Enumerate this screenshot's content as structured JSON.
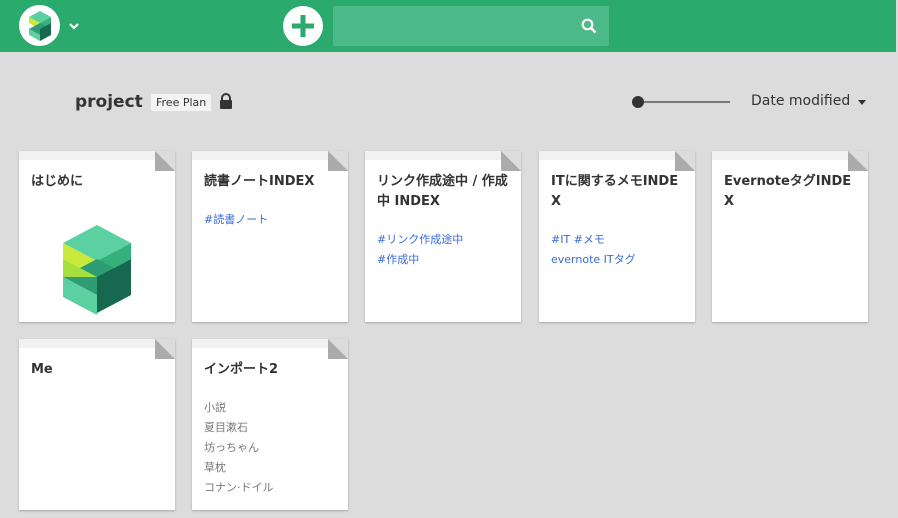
{
  "header": {
    "search_placeholder": ""
  },
  "project": {
    "name": "project",
    "plan": "Free Plan",
    "sort_label": "Date modified"
  },
  "cards": [
    {
      "title": "はじめに"
    },
    {
      "title": "読書ノートINDEX",
      "tags": [
        "#読書ノート"
      ]
    },
    {
      "title": "リンク作成途中 / 作成中 INDEX",
      "tags": [
        "#リンク作成途中",
        "#作成中"
      ]
    },
    {
      "title": "ITに関するメモINDEX",
      "tags": [
        "#IT #メモ",
        "evernote ITタグ"
      ]
    },
    {
      "title": "EvernoteタグINDEX"
    },
    {
      "title": "Me"
    },
    {
      "title": "インポート2",
      "lines": [
        "小説",
        "夏目漱石",
        "坊っちゃん",
        "草枕",
        "コナン·ドイル"
      ]
    }
  ],
  "colors": {
    "header": "#2aaa6c",
    "tag_link": "#3a6bd6"
  }
}
